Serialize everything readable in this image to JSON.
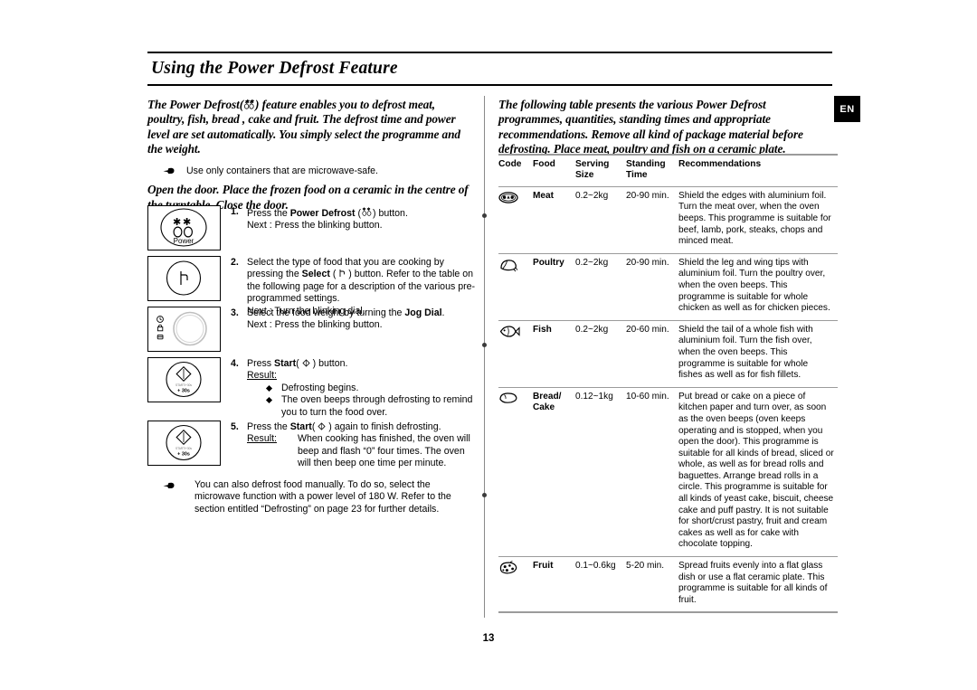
{
  "document": {
    "title": "Using the Power Defrost Feature",
    "page_number": "13",
    "language_badge": "EN"
  },
  "left": {
    "intro_before_icon": "The Power Defrost(",
    "intro_after_icon": ") feature enables you to defrost meat, poultry, fish, bread , cake and fruit. The defrost time and power level are set automatically. You simply select the programme and the weight.",
    "note": "Use only containers that are microwave-safe.",
    "open_door": "Open the door. Place the frozen food on a ceramic in the centre of the turntable. Close the door.",
    "steps": [
      {
        "num": "1.",
        "icon": "power-defrost-button",
        "icon_label": "Power",
        "line1_pre": "Press the ",
        "line1_bold": "Power Defrost",
        "line1_post": " (       ) button.",
        "line2": "Next : Press the blinking button."
      },
      {
        "num": "2.",
        "icon": "select-button",
        "line1_pre": "Select the type of food that you are cooking by pressing the ",
        "line1_bold": "Select",
        "line1_post": " (      ) button. Refer to the table on the following page for a description of the various pre-programmed settings.",
        "line2": "Next : Turn the blinking dial."
      },
      {
        "num": "3.",
        "icon": "jog-dial",
        "line1_pre": "Select the food weight by turning the ",
        "line1_bold": "Jog Dial",
        "line1_post": ".",
        "line2": "Next : Press the blinking button."
      },
      {
        "num": "4.",
        "icon": "start-button",
        "icon_label": "+ 30s",
        "line1_pre": "Press ",
        "line1_bold": "Start",
        "line1_post": "(      ) button.",
        "result_label": "Result:",
        "results": [
          "Defrosting begins.",
          "The oven beeps through defrosting to remind you to turn the food over."
        ]
      },
      {
        "num": "5.",
        "icon": "start-button",
        "icon_label": "+ 30s",
        "line1_pre": "Press the ",
        "line1_bold": "Start",
        "line1_post": "(      ) again to finish defrosting.",
        "result_label": "Result:",
        "result_text": "When cooking has finished, the oven will beep and flash “0” four times. The oven will then beep one time per minute."
      }
    ],
    "footer_note": "You can also defrost food manually. To do so, select the microwave function with a power level of 180 W. Refer to the section entitled “Defrosting” on page 23 for further details."
  },
  "right": {
    "intro": "The following table presents the various Power Defrost programmes, quantities, standing times and appropriate recommendations. Remove all kind of package material before defrosting. Place meat, poultry and fish on a ceramic plate.",
    "table": {
      "headers": [
        "Code",
        "Food",
        "Serving Size",
        "Standing Time",
        "Recommendations"
      ],
      "header_lines": [
        [
          "Code",
          ""
        ],
        [
          "Food",
          ""
        ],
        [
          "Serving",
          "Size"
        ],
        [
          "Standing",
          "Time"
        ],
        [
          "Recommendations",
          ""
        ]
      ],
      "rows": [
        {
          "icon": "meat-icon",
          "food": "Meat",
          "serving_size": "0.2~2kg",
          "standing_time": "20-90 min.",
          "recommendations": "Shield the edges with aluminium foil. Turn the meat over, when the oven beeps. This programme is suitable for beef, lamb, pork, steaks, chops and minced meat."
        },
        {
          "icon": "poultry-icon",
          "food": "Poultry",
          "serving_size": "0.2~2kg",
          "standing_time": "20-90 min.",
          "recommendations": "Shield the leg and wing tips with aluminium foil. Turn the poultry over, when the oven beeps. This programme is suitable for whole chicken as well as for chicken pieces."
        },
        {
          "icon": "fish-icon",
          "food": "Fish",
          "serving_size": "0.2~2kg",
          "standing_time": "20-60 min.",
          "recommendations": "Shield the tail of a whole fish with aluminium foil. Turn the fish over, when the oven beeps. This programme is suitable for whole fishes as well as for fish fillets."
        },
        {
          "icon": "bread-cake-icon",
          "food": "Bread/ Cake",
          "serving_size": "0.12~1kg",
          "standing_time": "10-60 min.",
          "recommendations": "Put bread or cake on a piece of kitchen paper and turn over, as soon as the oven beeps (oven keeps operating and is stopped, when you open the door). This programme is suitable for all kinds of bread, sliced or whole, as well as for bread rolls and baguettes. Arrange bread rolls in a circle. This programme is suitable for all kinds of yeast cake, biscuit, cheese cake and puff pastry. It is not suitable for short/crust pastry, fruit and cream cakes as well as for cake with chocolate topping."
        },
        {
          "icon": "fruit-icon",
          "food": "Fruit",
          "serving_size": "0.1~0.6kg",
          "standing_time": "5-20 min.",
          "recommendations": "Spread fruits evenly into a flat glass dish or use a flat ceramic plate. This programme is suitable for all kinds of fruit."
        }
      ]
    }
  }
}
